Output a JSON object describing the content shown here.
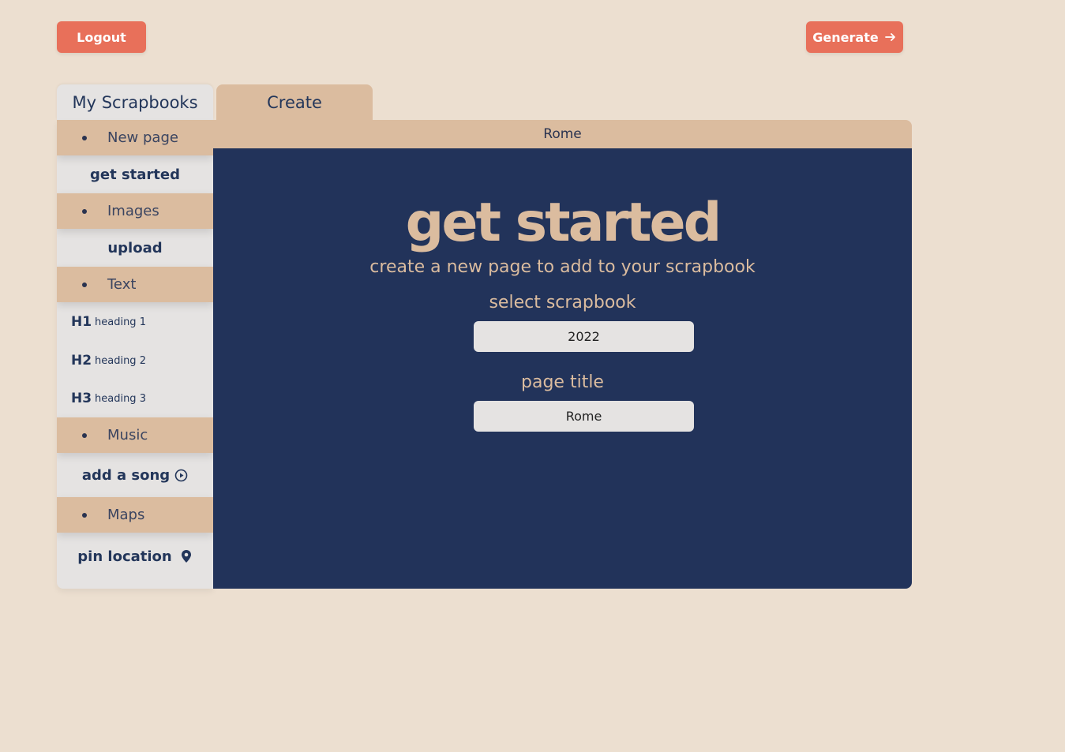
{
  "header": {
    "logout_label": "Logout",
    "generate_label": "Generate"
  },
  "tabs": {
    "scrapbooks_label": "My Scrapbooks",
    "create_label": "Create"
  },
  "sidebar": {
    "new_page": {
      "header": "New page",
      "action": "get started"
    },
    "images": {
      "header": "Images",
      "action": "upload"
    },
    "text": {
      "header": "Text",
      "headings": [
        {
          "icon": "H1",
          "label": "heading 1"
        },
        {
          "icon": "H2",
          "label": "heading 2"
        },
        {
          "icon": "H3",
          "label": "heading 3"
        }
      ]
    },
    "music": {
      "header": "Music",
      "action": "add a song"
    },
    "maps": {
      "header": "Maps",
      "action": "pin location"
    }
  },
  "main": {
    "page_name": "Rome",
    "title": "get started",
    "subtitle": "create a new page to add to your scrapbook",
    "select_label": "select scrapbook",
    "select_value": "2022",
    "page_title_label": "page title",
    "page_title_value": "Rome"
  },
  "colors": {
    "background": "#ecdfd0",
    "accent": "#e8705a",
    "tan": "#dbbc9f",
    "navy": "#22335a",
    "light_gray": "#e5e3e2"
  },
  "icons": {
    "generate": "arrow-right-icon",
    "add_song": "play-circle-icon",
    "pin_location": "map-pin-icon"
  }
}
